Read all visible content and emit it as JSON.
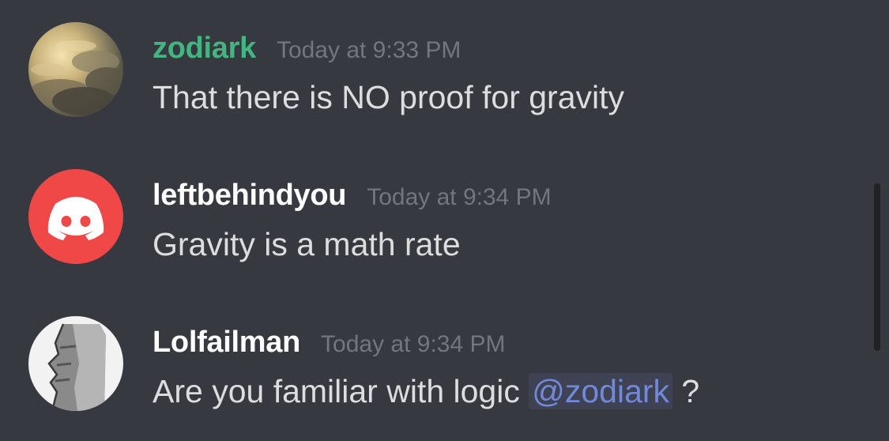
{
  "messages": [
    {
      "username": "zodiark",
      "timestamp": "Today at 9:33 PM",
      "content": "That there is NO proof for gravity",
      "username_color": "#43b581"
    },
    {
      "username": "leftbehindyou",
      "timestamp": "Today at 9:34 PM",
      "content": "Gravity is a math rate",
      "username_color": "#ffffff"
    },
    {
      "username": "Lolfailman",
      "timestamp": "Today at 9:34 PM",
      "content_before": "Are you familiar with logic ",
      "mention": "@zodiark",
      "content_after": " ?",
      "username_color": "#ffffff"
    }
  ],
  "colors": {
    "background": "#36393f",
    "timestamp": "#72767d",
    "message_text": "#dcddde",
    "mention_text": "#7289da",
    "mention_bg": "#3e4253",
    "discord_red_avatar": "#f04747"
  },
  "icons": {
    "avatar_1": "cloudy-sky-avatar",
    "avatar_2": "discord-logo-avatar",
    "avatar_3": "moai-statue-avatar"
  }
}
